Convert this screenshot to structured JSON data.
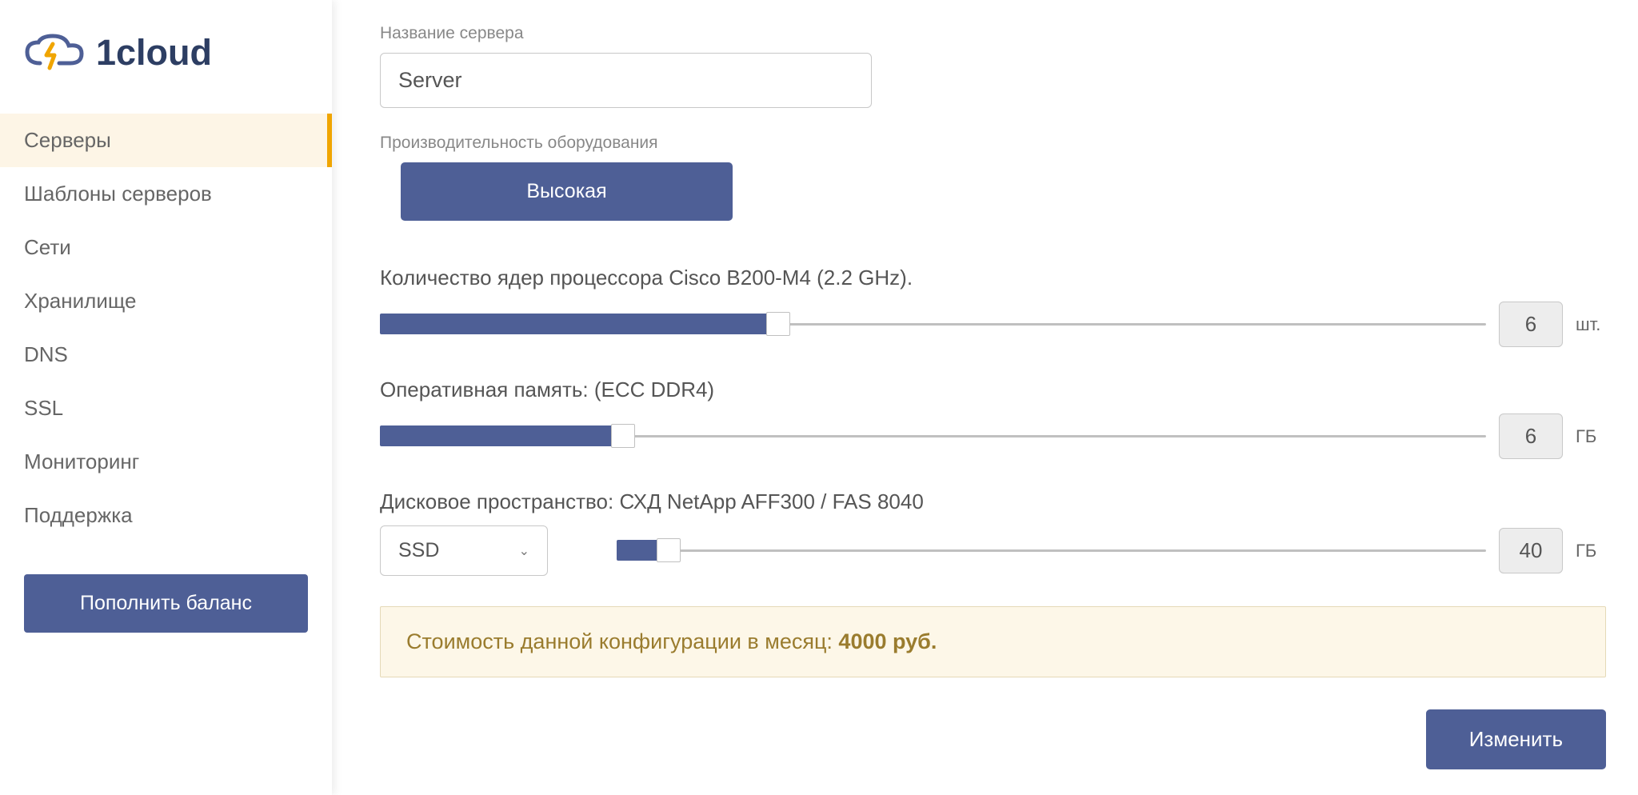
{
  "brand": {
    "name": "1cloud"
  },
  "sidebar": {
    "items": [
      {
        "label": "Серверы",
        "active": true
      },
      {
        "label": "Шаблоны серверов",
        "active": false
      },
      {
        "label": "Сети",
        "active": false
      },
      {
        "label": "Хранилище",
        "active": false
      },
      {
        "label": "DNS",
        "active": false
      },
      {
        "label": "SSL",
        "active": false
      },
      {
        "label": "Мониторинг",
        "active": false
      },
      {
        "label": "Поддержка",
        "active": false
      }
    ],
    "top_up_label": "Пополнить баланс"
  },
  "form": {
    "server_name_label": "Название сервера",
    "server_name_value": "Server",
    "performance_label": "Производительность оборудования",
    "performance_value": "Высокая",
    "cpu_label": "Количество ядер процессора Cisco B200-M4 (2.2 GHz).",
    "cpu_value": "6",
    "cpu_unit": "шт.",
    "cpu_fill_percent": 36,
    "ram_label": "Оперативная память: (ECC DDR4)",
    "ram_value": "6",
    "ram_unit": "ГБ",
    "ram_fill_percent": 22,
    "disk_label": "Дисковое пространство: СХД NetApp AFF300 / FAS 8040",
    "disk_type": "SSD",
    "disk_value": "40",
    "disk_unit": "ГБ",
    "disk_fill_percent": 6,
    "cost_prefix": "Стоимость данной конфигурации в месяц: ",
    "cost_value": "4000 руб.",
    "apply_label": "Изменить"
  }
}
